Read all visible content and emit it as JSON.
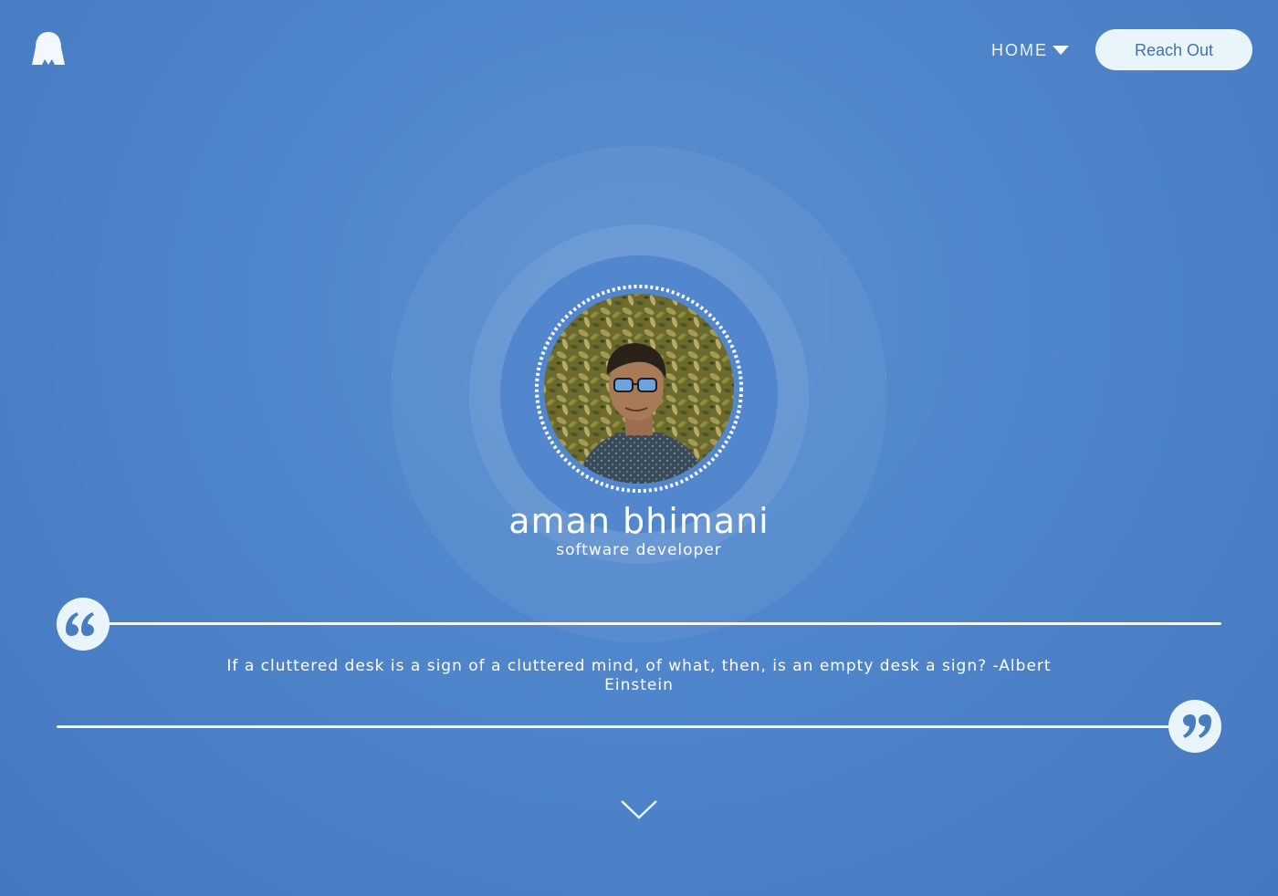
{
  "header": {
    "logo_icon": "ghost-logo-icon",
    "nav": {
      "home_label": "HOME",
      "caret_icon": "caret-down-icon"
    },
    "cta_label": "Reach Out"
  },
  "hero": {
    "name": "aman bhimani",
    "role": "software developer",
    "avatar_icon": "profile-photo"
  },
  "quote": {
    "text": "If a cluttered desk is a sign of a cluttered mind, of what, then, is an empty desk a sign? -Albert Einstein",
    "open_icon": "quote-open-icon",
    "close_icon": "quote-close-icon"
  },
  "scroll_icon": "chevron-down-icon",
  "colors": {
    "background": "#4f85cb",
    "accent_light": "#e9f5fb",
    "button_text": "#3e74b5",
    "text": "#ffffff"
  }
}
